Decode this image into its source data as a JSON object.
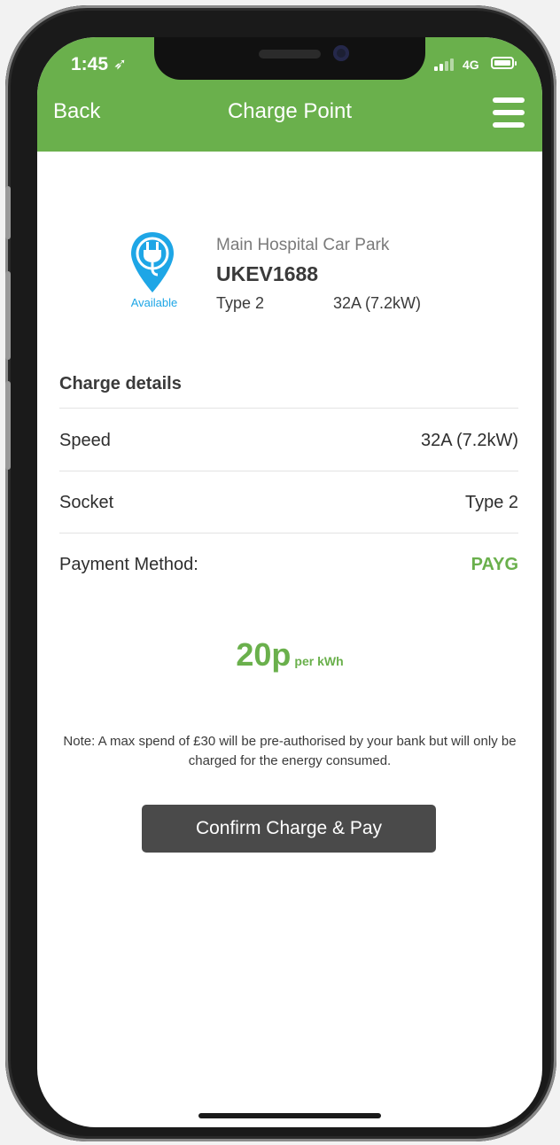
{
  "status_bar": {
    "time": "1:45",
    "network": "4G"
  },
  "header": {
    "back_label": "Back",
    "title": "Charge Point"
  },
  "charge_point": {
    "status": "Available",
    "location": "Main Hospital Car Park",
    "id": "UKEV1688",
    "connector_type": "Type 2",
    "power": "32A (7.2kW)"
  },
  "details": {
    "title": "Charge details",
    "rows": [
      {
        "label": "Speed",
        "value": "32A (7.2kW)"
      },
      {
        "label": "Socket",
        "value": "Type 2"
      },
      {
        "label": "Payment Method:",
        "value": "PAYG"
      }
    ]
  },
  "price": {
    "amount": "20p",
    "unit": "per kWh"
  },
  "note": "Note: A max spend of £30 will be pre-authorised by your bank but will only be charged for the energy consumed.",
  "confirm_label": "Confirm Charge & Pay",
  "colors": {
    "brand_green": "#6ab04c",
    "available_blue": "#1ea6e6",
    "button_dark": "#4a4a4a"
  }
}
